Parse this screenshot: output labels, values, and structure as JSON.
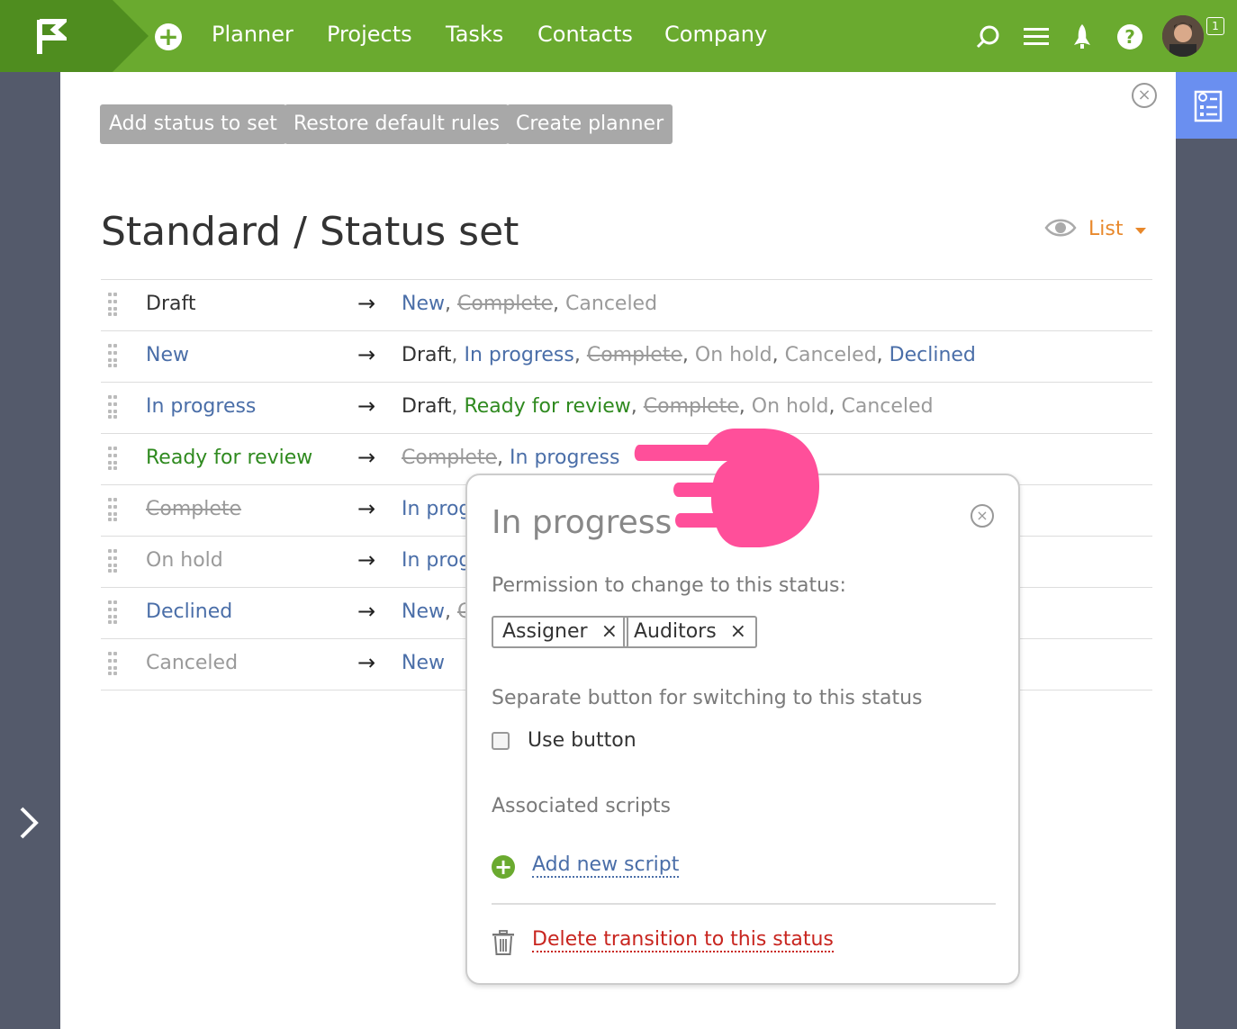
{
  "nav": {
    "items": [
      "Planner",
      "Projects",
      "Tasks",
      "Contacts",
      "Company"
    ],
    "badge": "1",
    "icons": [
      "search-icon",
      "menu-icon",
      "rocket-icon",
      "help-icon"
    ]
  },
  "toolbar": {
    "add_status": "Add status to set",
    "restore": "Restore default rules",
    "create_planner": "Create planner"
  },
  "page": {
    "title": "Standard / Status set",
    "view_mode": "List"
  },
  "colors": {
    "brand_green": "#6aaa2f",
    "link_blue": "#4a6ea8",
    "status_green": "#2f8a1f",
    "muted_gray": "#9a9a9a",
    "danger_red": "#c8251f",
    "accent_orange": "#e8882b",
    "hand_pink": "#ff4f9a"
  },
  "rows": [
    {
      "from": "Draft",
      "from_style": "dark",
      "arrow": "→",
      "targets": [
        {
          "t": "New",
          "s": "blue"
        },
        {
          "t": "Complete",
          "s": "strike"
        },
        {
          "t": "Canceled",
          "s": "gray"
        }
      ]
    },
    {
      "from": "New",
      "from_style": "blue",
      "arrow": "→",
      "targets": [
        {
          "t": "Draft",
          "s": "dark"
        },
        {
          "t": "In progress",
          "s": "blue"
        },
        {
          "t": "Complete",
          "s": "strike"
        },
        {
          "t": "On hold",
          "s": "gray"
        },
        {
          "t": "Canceled",
          "s": "gray"
        },
        {
          "t": "Declined",
          "s": "blue"
        }
      ]
    },
    {
      "from": "In progress",
      "from_style": "blue",
      "arrow": "→",
      "targets": [
        {
          "t": "Draft",
          "s": "dark"
        },
        {
          "t": "Ready for review",
          "s": "green"
        },
        {
          "t": "Complete",
          "s": "strike"
        },
        {
          "t": "On hold",
          "s": "gray"
        },
        {
          "t": "Canceled",
          "s": "gray"
        }
      ]
    },
    {
      "from": "Ready for review",
      "from_style": "green",
      "arrow": "→",
      "targets": [
        {
          "t": "Complete",
          "s": "strike"
        },
        {
          "t": "In progress",
          "s": "blue"
        }
      ]
    },
    {
      "from": "Complete",
      "from_style": "strike",
      "arrow": "→",
      "targets": [
        {
          "t": "In prog",
          "s": "blue"
        }
      ]
    },
    {
      "from": "On hold",
      "from_style": "gray",
      "arrow": "→",
      "targets": [
        {
          "t": "In prog",
          "s": "blue"
        }
      ]
    },
    {
      "from": "Declined",
      "from_style": "blue",
      "arrow": "→",
      "targets": [
        {
          "t": "New",
          "s": "blue"
        },
        {
          "t": "C",
          "s": "strike"
        }
      ]
    },
    {
      "from": "Canceled",
      "from_style": "gray",
      "arrow": "→",
      "targets": [
        {
          "t": "New",
          "s": "blue"
        }
      ]
    }
  ],
  "popup": {
    "title": "In progress",
    "permission_label": "Permission to change to this status:",
    "tags": [
      "Assigner",
      "Auditors"
    ],
    "tag_remove": "×",
    "separate_label": "Separate button for switching to this status",
    "use_button": "Use button",
    "scripts_label": "Associated scripts",
    "add_script": "Add new script",
    "delete_link": "Delete transition to this status"
  }
}
